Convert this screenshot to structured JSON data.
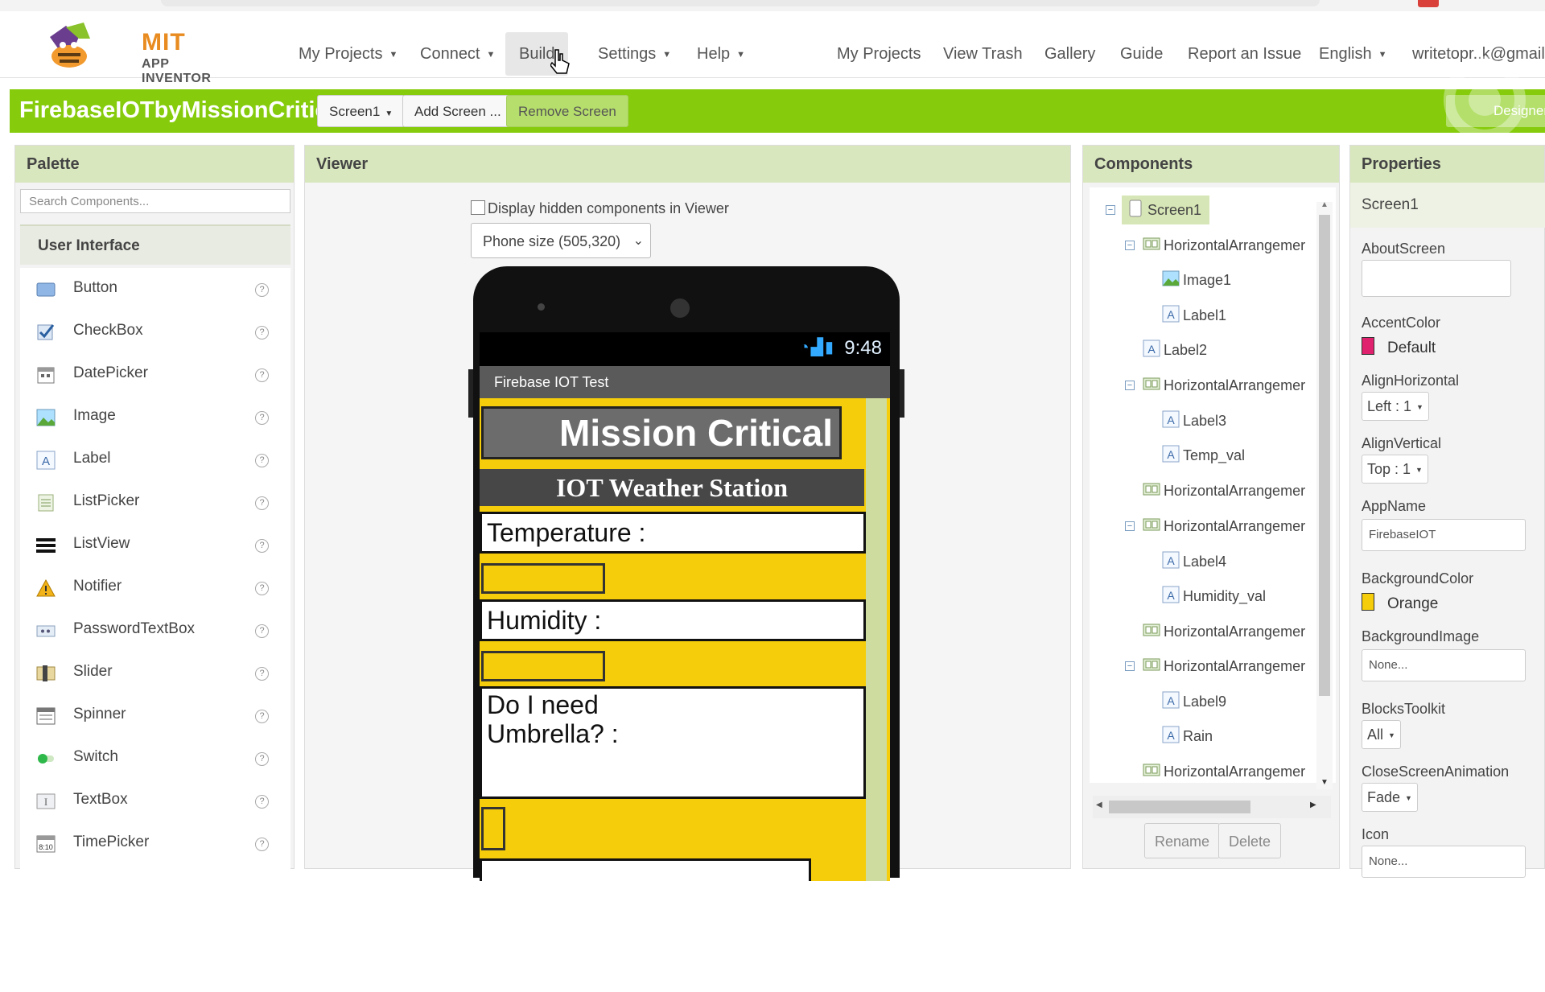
{
  "nav": {
    "logo_title": "MIT",
    "logo_subtitle": "APP INVENTOR",
    "menus": [
      "My Projects",
      "Connect",
      "Build",
      "Settings",
      "Help"
    ],
    "links": [
      "My Projects",
      "View Trash",
      "Gallery",
      "Guide",
      "Report an Issue",
      "English"
    ],
    "user_email": "writetopr..k@gmail"
  },
  "toolbar": {
    "project_name": "FirebaseIOTbyMissionCritical",
    "screen_select": "Screen1",
    "add_screen": "Add Screen ...",
    "remove_screen": "Remove Screen",
    "designer": "Designer"
  },
  "palette": {
    "title": "Palette",
    "search_placeholder": "Search Components...",
    "section": "User Interface",
    "items": [
      "Button",
      "CheckBox",
      "DatePicker",
      "Image",
      "Label",
      "ListPicker",
      "ListView",
      "Notifier",
      "PasswordTextBox",
      "Slider",
      "Spinner",
      "Switch",
      "TextBox",
      "TimePicker"
    ],
    "help_glyph": "?"
  },
  "viewer": {
    "title": "Viewer",
    "hidden_checkbox_label": "Display hidden components in Viewer",
    "phone_size": "Phone size (505,320)",
    "status_time": "9:48",
    "app_title": "Firebase IOT Test",
    "heading": "Mission Critical",
    "subheading": "IOT Weather Station",
    "temp_label": "Temperature :",
    "humidity_label": "Humidity :",
    "umbrella_line1": "Do I need",
    "umbrella_line2": "Umbrella? :"
  },
  "components": {
    "title": "Components",
    "tree": [
      "Screen1",
      "HorizontalArrangemer",
      "Image1",
      "Label1",
      "Label2",
      "HorizontalArrangemer",
      "Label3",
      "Temp_val",
      "HorizontalArrangemer",
      "HorizontalArrangemer",
      "Label4",
      "Humidity_val",
      "HorizontalArrangemer",
      "HorizontalArrangemer",
      "Label9",
      "Rain",
      "HorizontalArrangemer"
    ],
    "rename": "Rename",
    "delete": "Delete"
  },
  "properties": {
    "title": "Properties",
    "component": "Screen1",
    "about_screen": "AboutScreen",
    "accent_color": "AccentColor",
    "accent_value": "Default",
    "accent_hex": "#e0226e",
    "align_h": "AlignHorizontal",
    "align_h_value": "Left : 1",
    "align_v": "AlignVertical",
    "align_v_value": "Top : 1",
    "app_name": "AppName",
    "app_name_value": "FirebaseIOT",
    "bg_color": "BackgroundColor",
    "bg_color_value": "Orange",
    "bg_hex": "#f5cd0a",
    "bg_image": "BackgroundImage",
    "bg_image_value": "None...",
    "blocks_toolkit": "BlocksToolkit",
    "blocks_toolkit_value": "All",
    "close_anim": "CloseScreenAnimation",
    "close_anim_value": "Fade",
    "icon": "Icon",
    "icon_value": "None..."
  }
}
